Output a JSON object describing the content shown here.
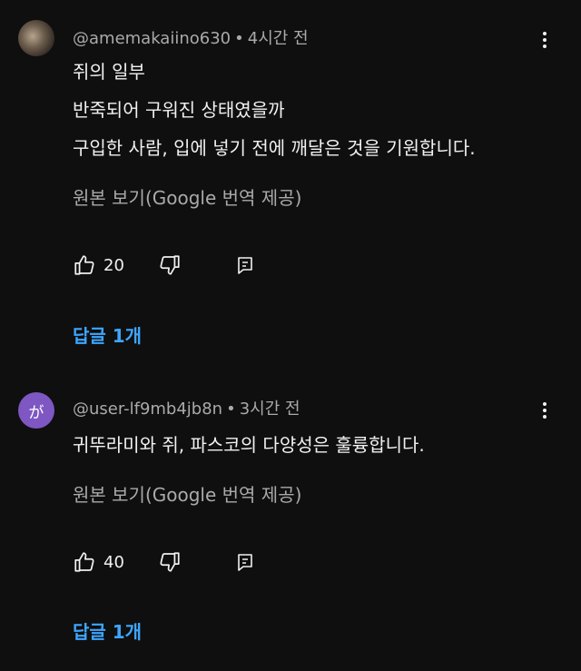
{
  "comments": [
    {
      "author": "@amemakaiino630",
      "separator": "•",
      "time": "4시간 전",
      "lines": [
        "쥐의 일부",
        "반죽되어 구워진 상태였을까",
        "구입한 사람, 입에 넣기 전에 깨달은 것을 기원합니다."
      ],
      "translate_label": "원본 보기(Google 번역 제공)",
      "likes": "20",
      "replies_label": "답글 1개"
    },
    {
      "avatar_letter": "が",
      "author": "@user-lf9mb4jb8n",
      "separator": "•",
      "time": "3시간 전",
      "lines": [
        "귀뚜라미와 쥐, 파스코의 다양성은 훌륭합니다."
      ],
      "translate_label": "원본 보기(Google 번역 제공)",
      "likes": "40",
      "replies_label": "답글 1개"
    }
  ],
  "icons": {
    "like": "thumb-up-icon",
    "dislike": "thumb-down-icon",
    "reply": "reply-comment-icon",
    "menu": "more-vertical-icon"
  },
  "colors": {
    "background": "#0f0f0f",
    "text": "#f1f1f1",
    "secondary_text": "#aaaaaa",
    "link": "#3ea6ff",
    "avatar_letter_bg": "#7e57c2"
  }
}
